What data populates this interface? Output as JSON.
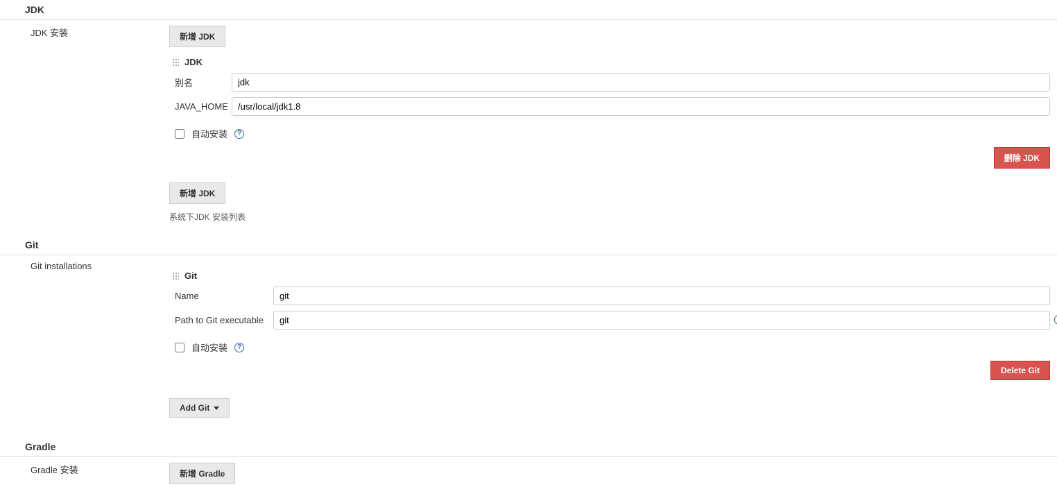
{
  "jdk": {
    "header": "JDK",
    "install_label": "JDK 安装",
    "add_button": "新增 JDK",
    "item_title": "JDK",
    "alias_label": "别名",
    "alias_value": "jdk",
    "home_label": "JAVA_HOME",
    "home_value": "/usr/local/jdk1.8",
    "auto_install": "自动安装",
    "delete_button": "删除 JDK",
    "add_button2": "新增 JDK",
    "desc": "系统下JDK 安装列表"
  },
  "git": {
    "header": "Git",
    "install_label": "Git installations",
    "item_title": "Git",
    "name_label": "Name",
    "name_value": "git",
    "path_label": "Path to Git executable",
    "path_value": "git",
    "auto_install": "自动安装",
    "delete_button": "Delete Git",
    "add_button": "Add Git"
  },
  "gradle": {
    "header": "Gradle",
    "install_label": "Gradle 安装",
    "add_button": "新增 Gradle"
  }
}
